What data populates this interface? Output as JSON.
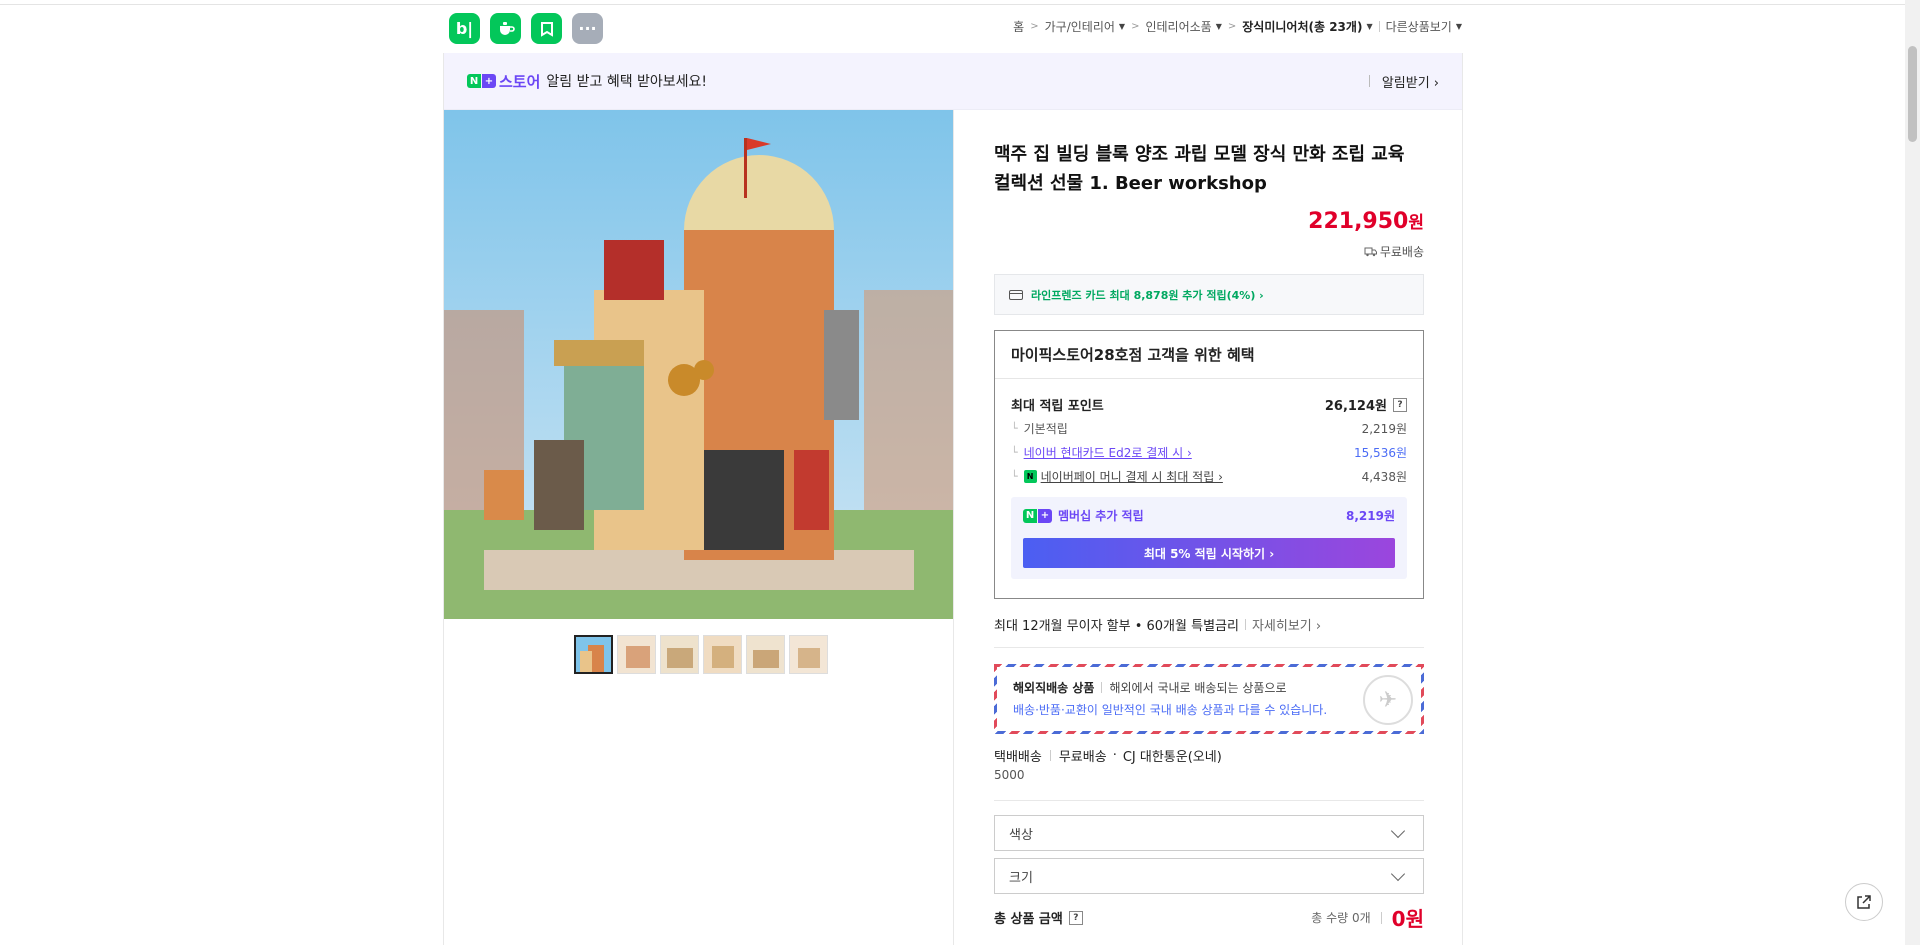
{
  "top_icons": [
    {
      "label": "b|",
      "icon": "blog-icon"
    },
    {
      "label": "",
      "icon": "cafe-icon"
    },
    {
      "label": "",
      "icon": "bookmark-icon"
    },
    {
      "label": "···",
      "icon": "more-icon"
    }
  ],
  "breadcrumb": {
    "home": "홈",
    "cat1": "가구/인테리어",
    "cat2": "인테리어소품",
    "cat3": "장식미니어처",
    "count": "(총 23개)",
    "other": "다른상품보기"
  },
  "alarm": {
    "n": "N",
    "plus": "+",
    "store": "스토어",
    "text": "알림 받고 혜택 받아보세요!",
    "action": "알림받기 ›"
  },
  "product": {
    "title": "맥주 집 빌딩 블록 양조 과립 모델 장식 만화 조립 교육 컬렉션 선물 1. Beer workshop",
    "price": "221,950",
    "price_unit": "원",
    "shipping": "무료배송"
  },
  "card_offer": "라인프렌즈 카드 최대 8,878원 추가 적립(4%) ›",
  "benefit": {
    "head": "마이픽스토어28호점 고객을 위한 혜택",
    "max_label": "최대 적립 포인트",
    "max_value": "26,124원",
    "rows": [
      {
        "label": "기본적립",
        "value": "2,219원"
      },
      {
        "label": "네이버 현대카드 Ed2로 결제 시 ›",
        "value": "15,536원"
      },
      {
        "label": "네이버페이 머니 결제 시 최대 적립 ›",
        "value": "4,438원"
      }
    ],
    "member_label": "멤버십 추가 적립",
    "member_value": "8,219원",
    "member_btn": "최대 5% 적립 시작하기 ›"
  },
  "installment": {
    "text": "최대 12개월 무이자 할부 • 60개월 특별금리",
    "more": "자세히보기 ›"
  },
  "overseas": {
    "title": "해외직배송 상품",
    "desc": "해외에서 국내로 배송되는 상품으로",
    "note": "배송·반품·교환이 일반적인 국내 배송 상품과 다를 수 있습니다."
  },
  "delivery": {
    "type": "택배배송",
    "fee": "무료배송",
    "carrier": "CJ 대한통운(오네)",
    "fee_note": "5000"
  },
  "options": {
    "color": "색상",
    "size": "크기"
  },
  "total": {
    "label": "총 상품 금액",
    "qty": "총 수량 0개",
    "amount": "0원"
  },
  "colors": {
    "naver_green": "#03c75a",
    "accent_purple": "#6b47f5",
    "price_red": "#e0002a"
  }
}
